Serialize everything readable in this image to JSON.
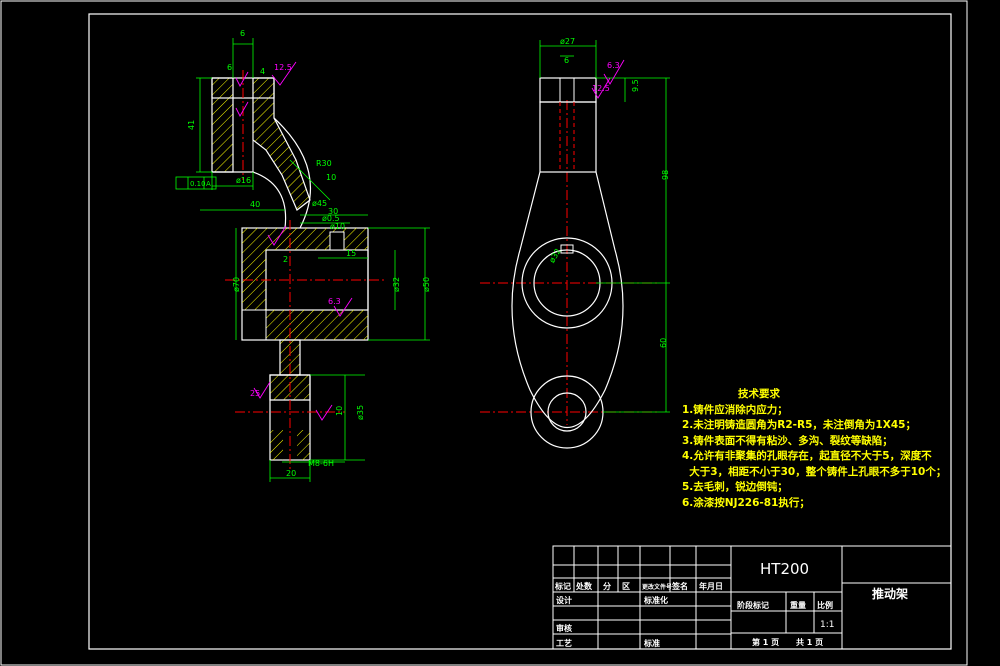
{
  "colors": {
    "background": "#000000",
    "frame": "#ffffff",
    "outline": "#ffffff",
    "dimension": "#00ff00",
    "centerline": "#ff0000",
    "hatch": "#ffff00",
    "roughness": "#ff00ff",
    "notes": "#ffff00"
  },
  "dimensions": {
    "d6_top": "6",
    "d6_left": "6",
    "d12_5": "12.5",
    "d4": "4",
    "d41": "41",
    "d16": "ø16",
    "tol": "0.10",
    "datum": "A",
    "d40": "40",
    "r30": "R30",
    "d10a": "10",
    "d45": "ø45",
    "d30b": "30",
    "d0_5": "ø0.5",
    "d10b": "ø10",
    "d15": "15",
    "d2": "2",
    "d70": "ø70",
    "d32": "ø32",
    "d50": "ø50",
    "r6_3a": "6.3",
    "d25": "25",
    "d10c": "10",
    "d35": "ø35",
    "m8": "M8-6H",
    "d20": "20",
    "d27": "ø27",
    "d6_right": "6",
    "r6_3b": "6.3",
    "r12_5b": "12.5",
    "d9_5": "9.5",
    "d98": "98",
    "d60": "60",
    "d32r": "ø32"
  },
  "notes": {
    "title": "技术要求",
    "items": [
      "1.铸件应消除内应力；",
      "2.未注明铸造圆角为R2-R5，未注倒角为1X45；",
      "3.铸件表面不得有粘沙、多沟、裂纹等缺陷；",
      "4.允许有非聚集的孔眼存在，起直径不大于5，深度不",
      "  大于3，相距不小于30，整个铸件上孔眼不多于10个；",
      "5.去毛刺，锐边倒钝；",
      "6.涂漆按NJ226-81执行；"
    ]
  },
  "title_block": {
    "material": "HT200",
    "part_name": "推动架",
    "col_headers": [
      "标记",
      "处数",
      "分",
      "区",
      "更改文件号",
      "签名",
      "年月日"
    ],
    "design": "设计",
    "standardize": "标准化",
    "stage_mark": "阶段标记",
    "weight": "重量",
    "ratio": "比例",
    "scale": "1:1",
    "review": "审核",
    "process": "工艺",
    "approve": "标准",
    "sheet": "第 1 页",
    "total": "共 1 页"
  }
}
